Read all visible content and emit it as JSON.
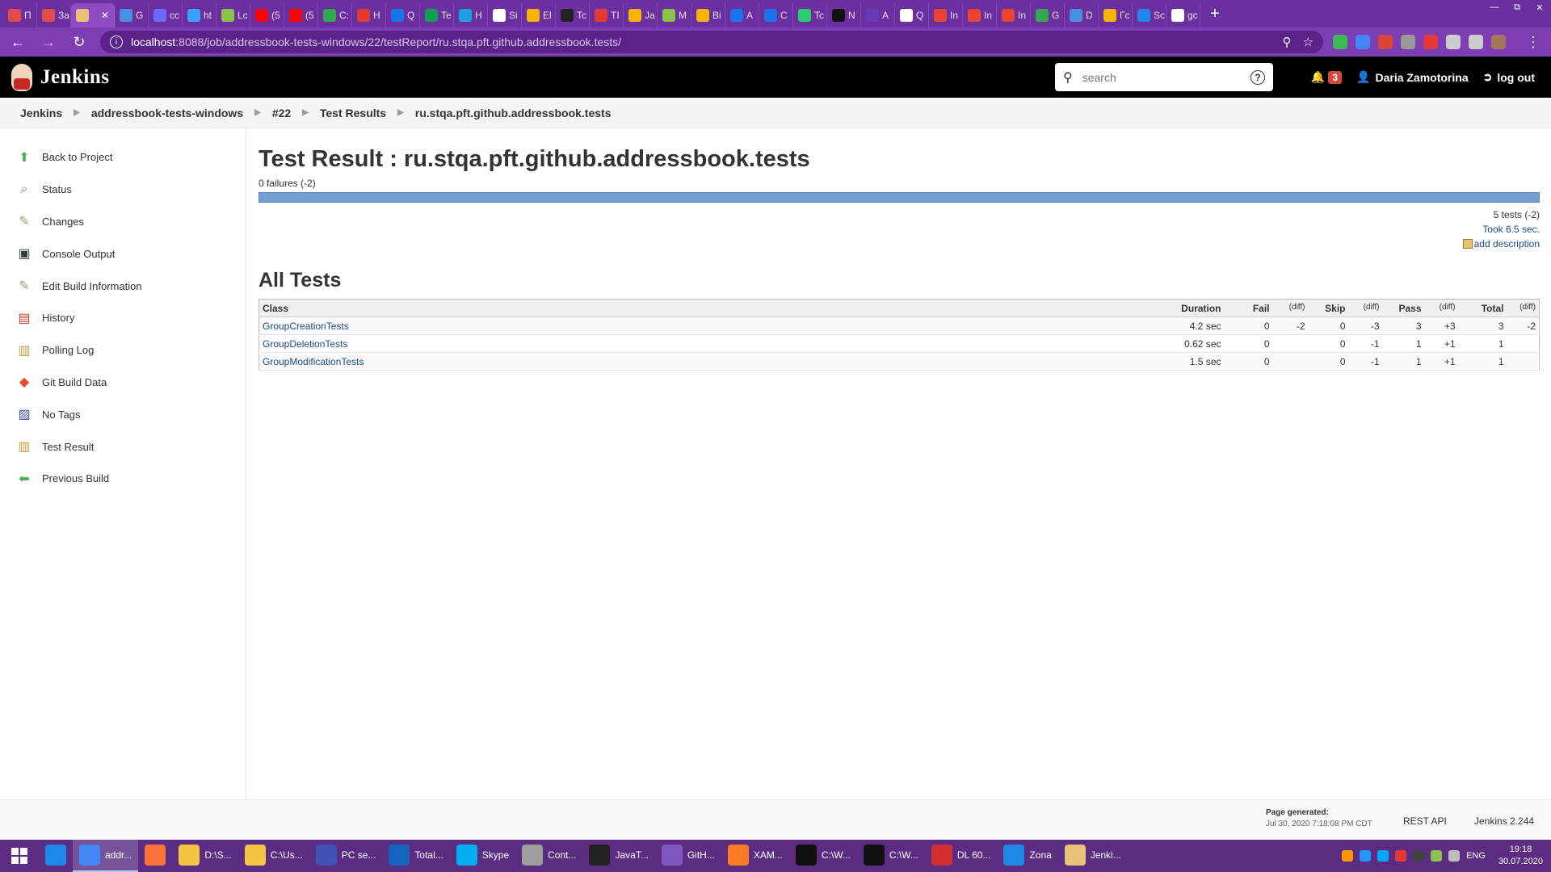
{
  "browser": {
    "tabs": [
      {
        "label": "П",
        "color": "#e04b4b"
      },
      {
        "label": "За",
        "color": "#e04b4b"
      },
      {
        "label": "",
        "color": "#e9c27a",
        "active": true
      },
      {
        "label": "G",
        "color": "#4a90e2"
      },
      {
        "label": "cc",
        "color": "#6b6bff"
      },
      {
        "label": "ht",
        "color": "#3aa0ff"
      },
      {
        "label": "Lc",
        "color": "#8bc34a"
      },
      {
        "label": "(5",
        "color": "#ff0000"
      },
      {
        "label": "(5",
        "color": "#ff0000"
      },
      {
        "label": "C:",
        "color": "#34a853"
      },
      {
        "label": "H",
        "color": "#e53935"
      },
      {
        "label": "Q",
        "color": "#1a73e8"
      },
      {
        "label": "Te",
        "color": "#0f9d58"
      },
      {
        "label": "H",
        "color": "#1ba1e2"
      },
      {
        "label": "Si",
        "color": "#ffffff"
      },
      {
        "label": "El",
        "color": "#f4b400"
      },
      {
        "label": "Tc",
        "color": "#222222"
      },
      {
        "label": "TI",
        "color": "#e53935"
      },
      {
        "label": "Ja",
        "color": "#f4b400"
      },
      {
        "label": "M",
        "color": "#8bc34a"
      },
      {
        "label": "Bi",
        "color": "#f4b400"
      },
      {
        "label": "A",
        "color": "#1a73e8"
      },
      {
        "label": "C",
        "color": "#1a73e8"
      },
      {
        "label": "Tc",
        "color": "#2ecc71"
      },
      {
        "label": "N",
        "color": "#111111"
      },
      {
        "label": "A",
        "color": "#673ab7"
      },
      {
        "label": "Q",
        "color": "#ffffff"
      },
      {
        "label": "In",
        "color": "#ea4335"
      },
      {
        "label": "In",
        "color": "#ea4335"
      },
      {
        "label": "In",
        "color": "#ea4335"
      },
      {
        "label": "G",
        "color": "#34a853"
      },
      {
        "label": "D",
        "color": "#4a90e2"
      },
      {
        "label": "Гс",
        "color": "#f4b400"
      },
      {
        "label": "Sc",
        "color": "#1e88e5"
      },
      {
        "label": "gc",
        "color": "#ffffff"
      }
    ],
    "new_tab": "+",
    "url_host": "localhost",
    "url_path": ":8088/job/addressbook-tests-windows/22/testReport/ru.stqa.pft.github.addressbook.tests/",
    "extension_colors": [
      "#3cba54",
      "#4285f4",
      "#db4437",
      "#999999",
      "#e53935",
      "#cccccc",
      "#cccccc",
      "#a0785a"
    ]
  },
  "header": {
    "app_title": "Jenkins",
    "search_placeholder": "search",
    "notification_count": "3",
    "user_name": "Daria Zamotorina",
    "logout_label": "log out"
  },
  "breadcrumb": [
    "Jenkins",
    "addressbook-tests-windows",
    "#22",
    "Test Results",
    "ru.stqa.pft.github.addressbook.tests"
  ],
  "sidepanel": [
    {
      "label": "Back to Project",
      "icon": "arrow-up-icon",
      "color": "#4caf50"
    },
    {
      "label": "Status",
      "icon": "magnifier-icon",
      "color": "#5c7ea8"
    },
    {
      "label": "Changes",
      "icon": "notepad-icon",
      "color": "#b0956a"
    },
    {
      "label": "Console Output",
      "icon": "terminal-icon",
      "color": "#2e3b3e"
    },
    {
      "label": "Edit Build Information",
      "icon": "notepad-edit-icon",
      "color": "#b0956a"
    },
    {
      "label": "History",
      "icon": "history-icon",
      "color": "#c0392b"
    },
    {
      "label": "Polling Log",
      "icon": "clipboard-icon",
      "color": "#c89b3c"
    },
    {
      "label": "Git Build Data",
      "icon": "git-icon",
      "color": "#e84d31"
    },
    {
      "label": "No Tags",
      "icon": "save-icon",
      "color": "#3f51b5"
    },
    {
      "label": "Test Result",
      "icon": "clipboard-icon",
      "color": "#c89b3c"
    },
    {
      "label": "Previous Build",
      "icon": "arrow-left-icon",
      "color": "#4caf50"
    }
  ],
  "main": {
    "title": "Test Result : ru.stqa.pft.github.addressbook.tests",
    "failures": "0 failures (-2)",
    "pass_fraction": 1.0,
    "tests_summary": "5 tests (-2)",
    "took": "Took 6.5 sec.",
    "add_description": "add description",
    "all_tests_heading": "All Tests"
  },
  "table": {
    "headers": {
      "class": "Class",
      "duration": "Duration",
      "fail": "Fail",
      "skip": "Skip",
      "pass": "Pass",
      "total": "Total",
      "diff": "(diff)"
    },
    "rows": [
      {
        "class": "GroupCreationTests",
        "duration": "4.2 sec",
        "fail": "0",
        "fail_diff": "-2",
        "skip": "0",
        "skip_diff": "-3",
        "pass": "3",
        "pass_diff": "+3",
        "total": "3",
        "total_diff": "-2"
      },
      {
        "class": "GroupDeletionTests",
        "duration": "0.62 sec",
        "fail": "0",
        "fail_diff": "",
        "skip": "0",
        "skip_diff": "-1",
        "pass": "1",
        "pass_diff": "+1",
        "total": "1",
        "total_diff": ""
      },
      {
        "class": "GroupModificationTests",
        "duration": "1.5 sec",
        "fail": "0",
        "fail_diff": "",
        "skip": "0",
        "skip_diff": "-1",
        "pass": "1",
        "pass_diff": "+1",
        "total": "1",
        "total_diff": ""
      }
    ]
  },
  "footer": {
    "page_generated_label": "Page generated:",
    "page_generated_date": "Jul 30, 2020 7:18:08 PM CDT",
    "rest_api": "REST API",
    "version": "Jenkins 2.244"
  },
  "taskbar": {
    "items": [
      {
        "label": "",
        "color": "#1e88e5"
      },
      {
        "label": "addr...",
        "color": "#4285f4",
        "active": true
      },
      {
        "label": "",
        "color": "#ff7139"
      },
      {
        "label": "D:\\S...",
        "color": "#f4c542"
      },
      {
        "label": "C:\\Us...",
        "color": "#f4c542"
      },
      {
        "label": "PC se...",
        "color": "#3f51b5"
      },
      {
        "label": "Total...",
        "color": "#1565c0"
      },
      {
        "label": "Skype",
        "color": "#00aff0"
      },
      {
        "label": "Cont...",
        "color": "#9e9e9e"
      },
      {
        "label": "JavaT...",
        "color": "#222222"
      },
      {
        "label": "GitH...",
        "color": "#7e57c2"
      },
      {
        "label": "XAM...",
        "color": "#fb7a24"
      },
      {
        "label": "C:\\W...",
        "color": "#111111"
      },
      {
        "label": "C:\\W...",
        "color": "#111111"
      },
      {
        "label": "DL 60...",
        "color": "#d32f2f"
      },
      {
        "label": "Zona",
        "color": "#1e88e5"
      },
      {
        "label": "Jenki...",
        "color": "#e9c27a"
      }
    ],
    "language": "ENG",
    "time": "19:18",
    "date": "30.07.2020"
  }
}
